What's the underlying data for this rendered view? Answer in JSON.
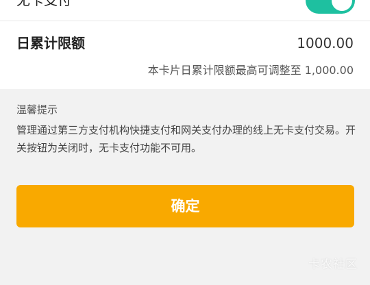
{
  "no_card_payment": {
    "label": "无卡支付",
    "toggle_on": true
  },
  "daily_limit": {
    "label": "日累计限额",
    "value": "1000.00",
    "note": "本卡片日累计限额最高可调整至 1,000.00"
  },
  "tips": {
    "title": "温馨提示",
    "body": "管理通过第三方支付机构快捷支付和网关支付办理的线上无卡支付交易。开关按钮为关闭时，无卡支付功能不可用。"
  },
  "confirm_label": "确定",
  "watermark": "卡农社区",
  "colors": {
    "toggle_on": "#1ec0a0",
    "confirm": "#f9a900",
    "background": "#f2f2f2"
  }
}
